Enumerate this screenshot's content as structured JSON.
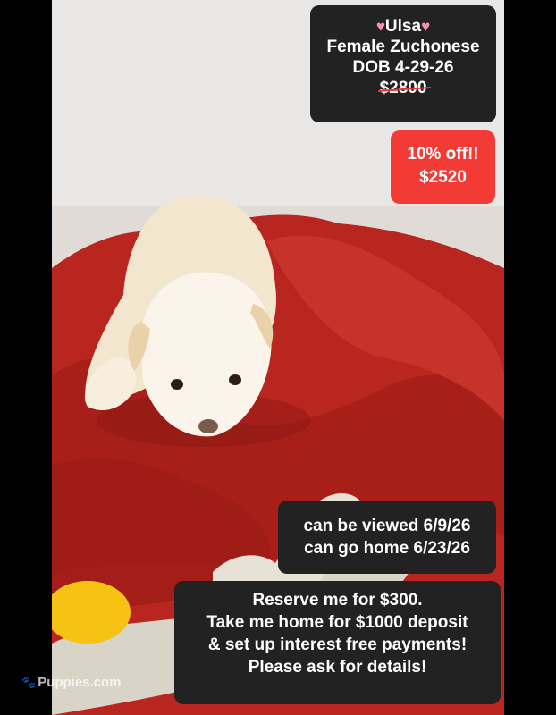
{
  "listing": {
    "name": "Ulsa",
    "heart_icon": "heart-icon",
    "breed_line": "Female Zuchonese",
    "dob_line": "DOB 4-29-26",
    "original_price": "$2800"
  },
  "discount": {
    "label": "10% off!!",
    "price": "$2520"
  },
  "dates": {
    "viewing": "can be viewed 6/9/26",
    "go_home": "can go home 6/23/26"
  },
  "reserve": {
    "line1": "Reserve me for $300.",
    "line2": "Take me home for $1000 deposit",
    "line3": "& set up interest free payments!",
    "line4": "Please ask for details!"
  },
  "watermark": {
    "text": "Puppies.com"
  },
  "colors": {
    "dark_box": "#222222",
    "red_box": "#f23b34",
    "blanket": "#b8261f",
    "puppy": "#f4e9d6"
  }
}
